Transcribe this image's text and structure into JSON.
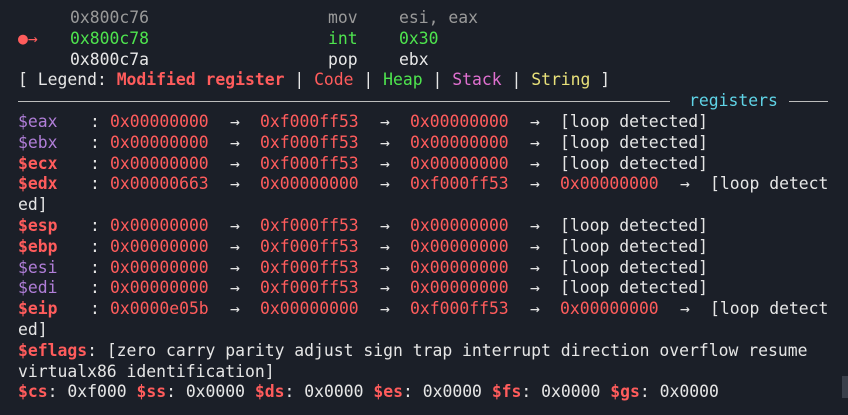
{
  "disasm": [
    {
      "marker": "",
      "addr": "0x800c76",
      "op": "mov",
      "args": "esi, eax"
    },
    {
      "marker": "●→",
      "addr": "0x800c78",
      "op": "int",
      "args": "0x30"
    },
    {
      "marker": "",
      "addr": "0x800c7a",
      "op": "pop",
      "args": "ebx"
    }
  ],
  "legend": {
    "open": "[ Legend: ",
    "modified": "Modified register",
    "sep": " | ",
    "code": "Code",
    "heap": "Heap",
    "stack": "Stack",
    "string": "String",
    "close": " ]"
  },
  "section_title": "registers",
  "arrow": "→",
  "registers": [
    {
      "name": "$eax",
      "chain": [
        "0x00000000",
        "0xf000ff53",
        "0x00000000"
      ],
      "tail": "[loop detected]"
    },
    {
      "name": "$ebx",
      "chain": [
        "0x00000000",
        "0xf000ff53",
        "0x00000000"
      ],
      "tail": "[loop detected]"
    },
    {
      "name": "$ecx",
      "chain": [
        "0x00000000",
        "0xf000ff53",
        "0x00000000"
      ],
      "tail": "[loop detected]"
    },
    {
      "name": "$edx",
      "chain": [
        "0x00000663",
        "0x00000000",
        "0xf000ff53",
        "0x00000000"
      ],
      "tail": "[loop detect",
      "wrap": "ed]"
    },
    {
      "name": "$esp",
      "chain": [
        "0x00000000",
        "0xf000ff53",
        "0x00000000"
      ],
      "tail": "[loop detected]"
    },
    {
      "name": "$ebp",
      "chain": [
        "0x00000000",
        "0xf000ff53",
        "0x00000000"
      ],
      "tail": "[loop detected]"
    },
    {
      "name": "$esi",
      "chain": [
        "0x00000000",
        "0xf000ff53",
        "0x00000000"
      ],
      "tail": "[loop detected]"
    },
    {
      "name": "$edi",
      "chain": [
        "0x00000000",
        "0xf000ff53",
        "0x00000000"
      ],
      "tail": "[loop detected]"
    },
    {
      "name": "$eip",
      "chain": [
        "0x0000e05b",
        "0x00000000",
        "0xf000ff53",
        "0x00000000"
      ],
      "tail": "[loop detect",
      "wrap": "ed]"
    }
  ],
  "eflags": {
    "name": "$eflags",
    "line1": ": [zero carry parity adjust sign trap interrupt direction overflow resume",
    "line2": "virtualx86 identification]"
  },
  "segments": [
    {
      "name": "$cs",
      "value": "0xf000"
    },
    {
      "name": "$ss",
      "value": "0x0000"
    },
    {
      "name": "$ds",
      "value": "0x0000"
    },
    {
      "name": "$es",
      "value": "0x0000"
    },
    {
      "name": "$fs",
      "value": "0x0000"
    },
    {
      "name": "$gs",
      "value": "0x0000"
    }
  ],
  "colors": {
    "modified_register": "#ff5c5c",
    "register_unchanged": "#b07ed8",
    "code": "#ff5c5c",
    "heap": "#4ee44e",
    "stack": "#e070d0",
    "string": "#e8e07a",
    "section_title": "#5fd3e6",
    "current_instruction": "#4ee44e"
  }
}
